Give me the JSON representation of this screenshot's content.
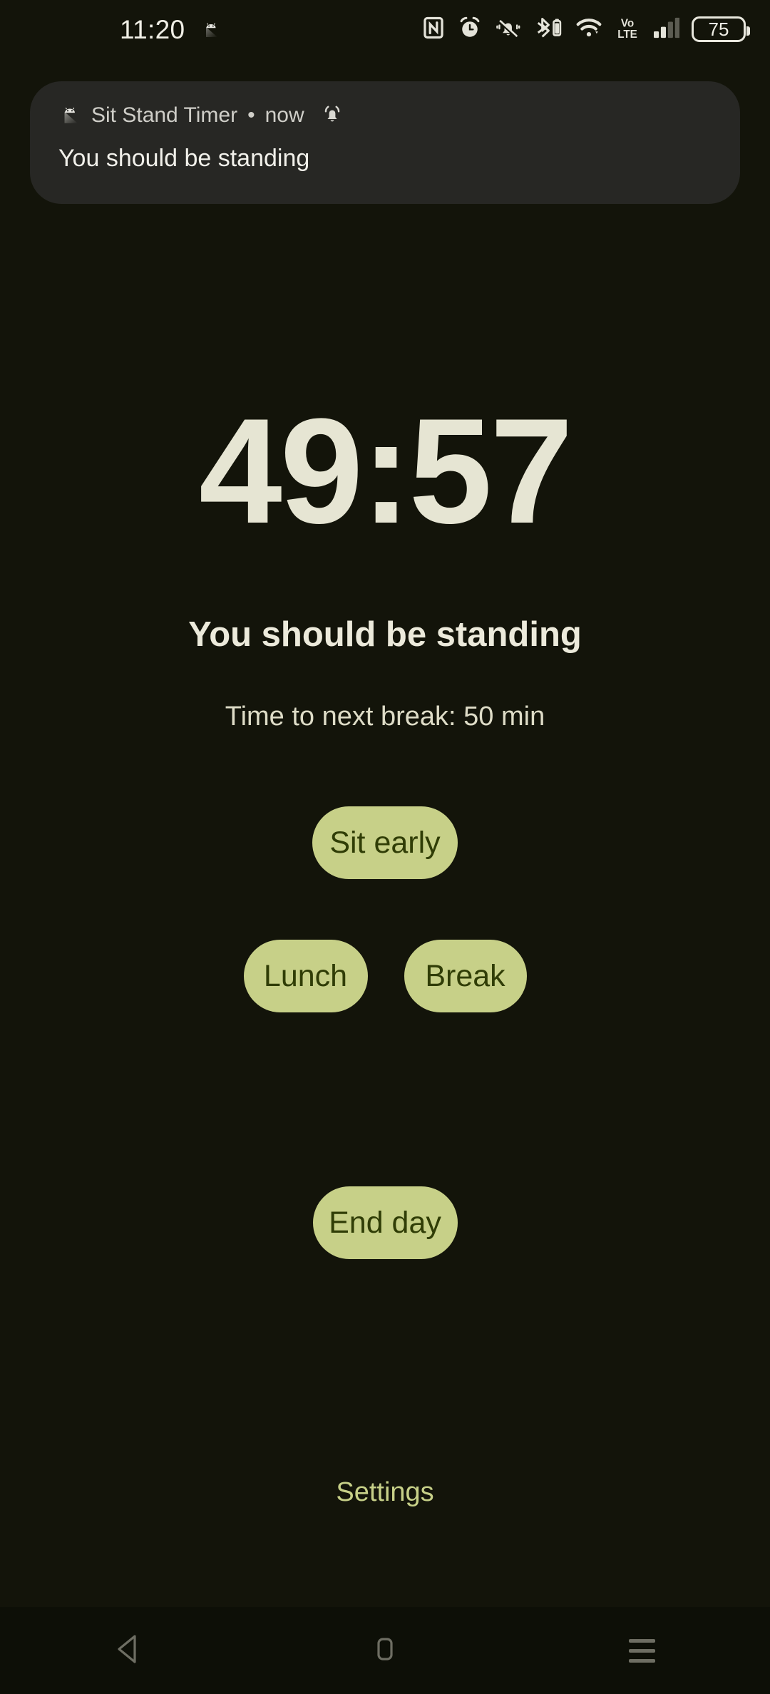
{
  "status_bar": {
    "clock": "11:20",
    "notification_icon": "android-app-icon",
    "icons": [
      {
        "name": "nfc-icon",
        "label": "NFC"
      },
      {
        "name": "alarm-icon",
        "label": "Alarm set"
      },
      {
        "name": "mute-bell-icon",
        "label": "Ringer muted"
      },
      {
        "name": "bluetooth-battery-icon",
        "label": "Bluetooth device battery"
      },
      {
        "name": "wifi-icon",
        "label": "Wi-Fi connected"
      },
      {
        "name": "volte-icon",
        "label": "VoLTE"
      },
      {
        "name": "signal-bars-icon",
        "label": "Mobile signal"
      }
    ],
    "volte_line1": "Vo",
    "volte_line2": "LTE",
    "battery_percent": "75"
  },
  "notification": {
    "app_icon": "android-app-icon",
    "app_name": "Sit Stand Timer",
    "separator": "•",
    "time": "now",
    "alert_icon": "ringing-bell-icon",
    "body": "You should be standing"
  },
  "main": {
    "timer": "49:57",
    "headline": "You should be standing",
    "subline": "Time to next break: 50 min",
    "buttons": {
      "sit_early": "Sit early",
      "lunch": "Lunch",
      "break": "Break",
      "end_day": "End day"
    },
    "settings_link": "Settings"
  },
  "nav_bar": {
    "back": "back-button",
    "home": "home-button",
    "recents": "recents-button"
  },
  "colors": {
    "background": "#13140a",
    "accent": "#c7d088",
    "accent_text": "#303d06",
    "timer_text": "#e6e5d3",
    "notification_card": "#272724",
    "nav_bar": "#0d0f07"
  }
}
